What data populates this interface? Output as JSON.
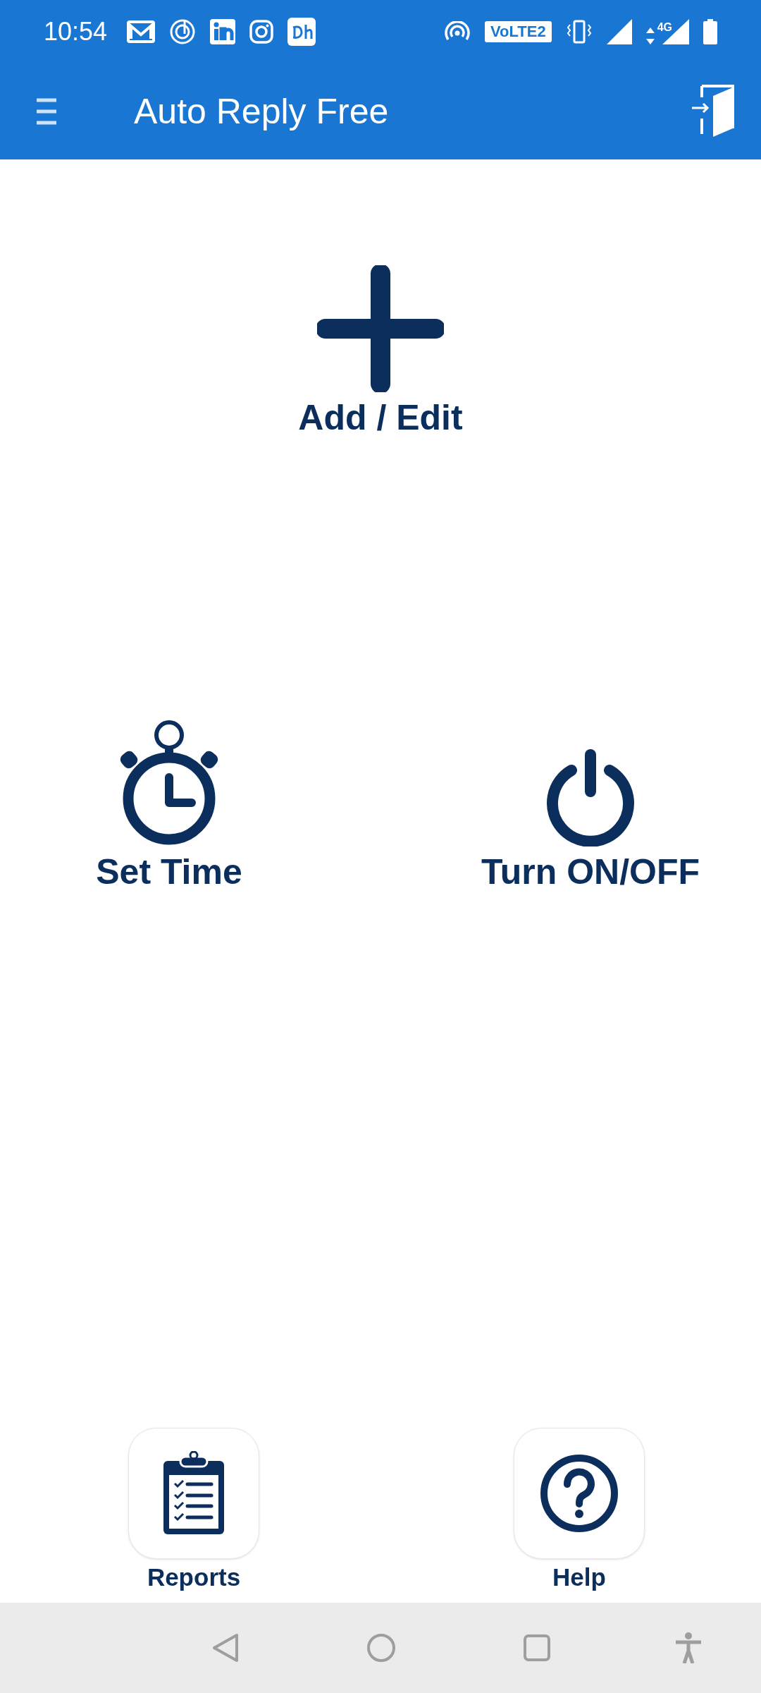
{
  "status_bar": {
    "time": "10:54",
    "volte": "VoLTE2",
    "network": "4G"
  },
  "app_bar": {
    "title": "Auto Reply Free"
  },
  "actions": [
    {
      "kind": "add",
      "label": "Add / Edit"
    },
    {
      "kind": "timer",
      "label": "Set Time"
    },
    {
      "kind": "power",
      "label": "Turn ON/OFF"
    }
  ],
  "shortcuts": [
    {
      "kind": "reports",
      "label": "Reports"
    },
    {
      "kind": "help",
      "label": "Help"
    }
  ]
}
